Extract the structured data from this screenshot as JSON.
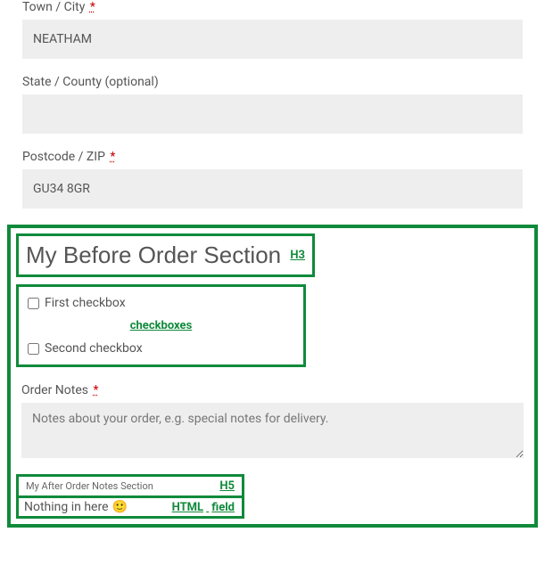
{
  "town": {
    "label": "Town / City",
    "required": "*",
    "value": "NEATHAM"
  },
  "state": {
    "label": "State / County (optional)",
    "value": ""
  },
  "postcode": {
    "label": "Postcode / ZIP",
    "required": "*",
    "value": "GU34 8GR"
  },
  "beforeSection": {
    "title": "My Before Order Section",
    "tag": "H3"
  },
  "checkboxes": {
    "first": "First checkbox",
    "second": "Second checkbox",
    "tag": "checkboxes"
  },
  "orderNotes": {
    "label": "Order Notes",
    "required": "*",
    "placeholder": "Notes about your order, e.g. special notes for delivery."
  },
  "afterSection": {
    "title": "My After Order Notes Section",
    "tag": "H5"
  },
  "htmlField": {
    "text": "Nothing in here",
    "emoji": "🙂",
    "tag1": "HTML",
    "tag2": "field"
  }
}
